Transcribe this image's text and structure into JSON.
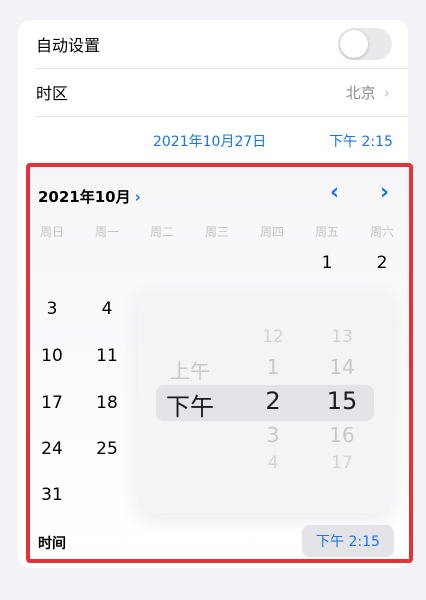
{
  "settings": {
    "auto_set_label": "自动设置",
    "auto_set_enabled": false,
    "timezone_label": "时区",
    "timezone_value": "北京",
    "date_display": "2021年10月27日",
    "time_display": "下午 2:15"
  },
  "calendar": {
    "month_title": "2021年10月",
    "weekdays": [
      "周日",
      "周一",
      "周二",
      "周三",
      "周四",
      "周五",
      "周六"
    ],
    "days": [
      {
        "text": "1",
        "col": 5,
        "row": 0
      },
      {
        "text": "2",
        "col": 6,
        "row": 0
      },
      {
        "text": "3",
        "col": 0,
        "row": 1
      },
      {
        "text": "4",
        "col": 1,
        "row": 1
      },
      {
        "text": "10",
        "col": 0,
        "row": 2
      },
      {
        "text": "11",
        "col": 1,
        "row": 2
      },
      {
        "text": "17",
        "col": 0,
        "row": 3
      },
      {
        "text": "18",
        "col": 1,
        "row": 3
      },
      {
        "text": "24",
        "col": 0,
        "row": 4
      },
      {
        "text": "25",
        "col": 1,
        "row": 4
      },
      {
        "text": "31",
        "col": 0,
        "row": 5
      }
    ]
  },
  "time_wheel": {
    "period": {
      "items": [
        "上午",
        "下午"
      ],
      "selected": 1
    },
    "hours": {
      "items": [
        "12",
        "1",
        "2",
        "3",
        "4"
      ],
      "selected": 2
    },
    "minutes": {
      "items": [
        "13",
        "14",
        "15",
        "16",
        "17"
      ],
      "selected": 2
    }
  },
  "footer": {
    "time_label": "时间",
    "time_value": "下午 2:15"
  },
  "colors": {
    "accent": "#1a73e8",
    "highlight_border": "#e53238"
  },
  "icons": {
    "month_expand": "chevron-right-icon",
    "prev_month": "chevron-left-icon",
    "next_month": "chevron-right-icon",
    "timezone_disclosure": "chevron-right-icon"
  }
}
